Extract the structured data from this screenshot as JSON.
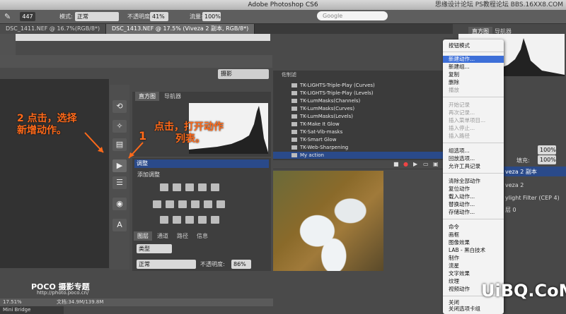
{
  "app_title": "Adobe Photoshop CS6",
  "watermark_top": "思缘设计论坛 PS教程论坛 BBS.16XX8.COM",
  "options_bar": {
    "brush_size": "447",
    "mode_label": "模式:",
    "mode_value": "正常",
    "opacity_label": "不透明度:",
    "opacity_value": "41%",
    "flow_label": "流量:",
    "flow_value": "100%",
    "search_placeholder": "Google"
  },
  "doc_tabs": [
    {
      "label": "DSC_1411.NEF @ 16.7%(RGB/8*)"
    },
    {
      "label": "DSC_1413.NEF @ 17.5% (Viveza 2 副本, RGB/8*)"
    }
  ],
  "panel_select": "摄影",
  "histogram_panel": {
    "tabs": [
      "直方图",
      "导航器"
    ]
  },
  "adjust_panel": {
    "header": "调整",
    "sub": "添加调整"
  },
  "layers_panel": {
    "tabs": [
      "图层",
      "通道",
      "路径",
      "信息"
    ],
    "kind_label": "类型",
    "blend_value": "正常",
    "opacity_label": "不透明度:",
    "opacity_value": "86%"
  },
  "actions_panel": {
    "title": "佐制滤",
    "rows": [
      "TK-LIGHTS-Triple-Play (Curves)",
      "TK-LIGHTS-Triple-Play (Levels)",
      "TK-LumMasks(Channels)",
      "TK-LumMasks(Curves)",
      "TK-LumMasks(Levels)",
      "TK-Make It Glow",
      "TK-Sat-Vib-masks",
      "TK-Smart Glow",
      "TK-Web-Sharpening",
      "My action"
    ]
  },
  "context_menu": {
    "items": [
      {
        "label": "按钮模式",
        "state": "normal"
      },
      {
        "label": "新建动作...",
        "state": "highlight"
      },
      {
        "label": "新建组...",
        "state": "normal"
      },
      {
        "label": "复制",
        "state": "normal"
      },
      {
        "label": "删除",
        "state": "normal"
      },
      {
        "label": "播放",
        "state": "disabled"
      },
      {
        "label": "开始记录",
        "state": "disabled"
      },
      {
        "label": "再次记录...",
        "state": "disabled"
      },
      {
        "label": "插入菜单项目...",
        "state": "disabled"
      },
      {
        "label": "插入停止...",
        "state": "disabled"
      },
      {
        "label": "插入路径",
        "state": "disabled"
      },
      {
        "label": "组选项...",
        "state": "normal"
      },
      {
        "label": "回放选项...",
        "state": "normal"
      },
      {
        "label": "允许工具记录",
        "state": "normal"
      },
      {
        "label": "清除全部动作",
        "state": "normal"
      },
      {
        "label": "复位动作",
        "state": "normal"
      },
      {
        "label": "载入动作...",
        "state": "normal"
      },
      {
        "label": "替换动作...",
        "state": "normal"
      },
      {
        "label": "存储动作...",
        "state": "normal"
      },
      {
        "label": "命令",
        "state": "normal"
      },
      {
        "label": "画框",
        "state": "normal"
      },
      {
        "label": "图像效果",
        "state": "normal"
      },
      {
        "label": "LAB - 黑白技术",
        "state": "normal"
      },
      {
        "label": "制作",
        "state": "normal"
      },
      {
        "label": "流星",
        "state": "normal"
      },
      {
        "label": "文字效果",
        "state": "normal"
      },
      {
        "label": "纹理",
        "state": "normal"
      },
      {
        "label": "视频动作",
        "state": "normal"
      },
      {
        "label": "关闭",
        "state": "normal"
      },
      {
        "label": "关闭选项卡组",
        "state": "normal"
      }
    ]
  },
  "right_panel": {
    "tabs": [
      "直方图",
      "导航器"
    ],
    "opacity1": "100%",
    "opacity2": "100%",
    "fill_label": "填充:",
    "layer1": "veza 2 副本",
    "layer2": "veza 2",
    "layer3": "ylight Filter (CEP 4)",
    "layer4": "层 0"
  },
  "annotations": {
    "one_num": "1",
    "one_text_line1": "点击，打开动作",
    "one_text_line2": "列表。",
    "two_line1": "2 点击，选择",
    "two_line2": "新增动作。"
  },
  "status": {
    "zoom": "17.51%",
    "doc": "文档:34.9M/139.8M"
  },
  "mini_bridge": "Mini Bridge",
  "poco_title": "POCO 摄影专题",
  "poco_url": "http://photo.poco.cn/",
  "uibq": "UiBQ.CoM"
}
